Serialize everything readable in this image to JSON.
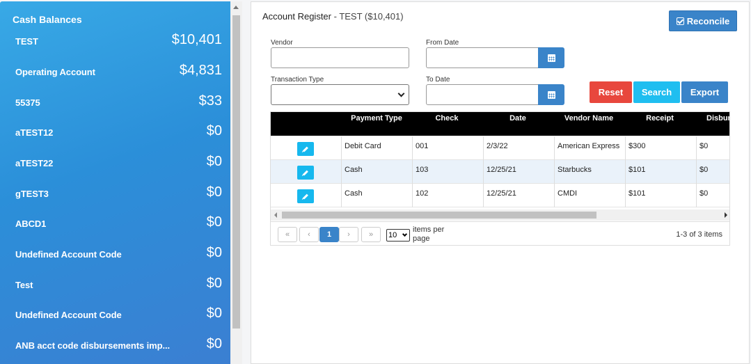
{
  "sidebar": {
    "title": "Cash Balances",
    "accounts": [
      {
        "name": "TEST",
        "amount": "$10,401"
      },
      {
        "name": "Operating Account",
        "amount": "$4,831"
      },
      {
        "name": "55375",
        "amount": "$33"
      },
      {
        "name": "aTEST12",
        "amount": "$0"
      },
      {
        "name": "aTEST22",
        "amount": "$0"
      },
      {
        "name": "gTEST3",
        "amount": "$0"
      },
      {
        "name": "ABCD1",
        "amount": "$0"
      },
      {
        "name": "Undefined Account Code",
        "amount": "$0"
      },
      {
        "name": "Test",
        "amount": "$0"
      },
      {
        "name": "Undefined Account Code",
        "amount": "$0"
      },
      {
        "name": "ANB acct code disbursements imp...",
        "amount": "$0"
      }
    ]
  },
  "header": {
    "title": "Account Register",
    "subtitle": " - TEST ($10,401)",
    "reconcile_label": "Reconcile"
  },
  "filters": {
    "vendor_label": "Vendor",
    "vendor_value": "",
    "from_date_label": "From Date",
    "from_date_value": "",
    "transaction_type_label": "Transaction Type",
    "transaction_type_value": "",
    "to_date_label": "To Date",
    "to_date_value": "",
    "reset_label": "Reset",
    "search_label": "Search",
    "export_label": "Export"
  },
  "grid": {
    "columns": [
      "",
      "Payment Type",
      "Check",
      "Date",
      "Vendor Name",
      "Receipt",
      "Disbur"
    ],
    "rows": [
      {
        "payment_type": "Debit Card",
        "check": "001",
        "date": "2/3/22",
        "vendor": "American Express",
        "receipt": "$300",
        "disbursement": "$0"
      },
      {
        "payment_type": "Cash",
        "check": "103",
        "date": "12/25/21",
        "vendor": "Starbucks",
        "receipt": "$101",
        "disbursement": "$0"
      },
      {
        "payment_type": "Cash",
        "check": "102",
        "date": "12/25/21",
        "vendor": "CMDI",
        "receipt": "$101",
        "disbursement": "$0"
      }
    ]
  },
  "pager": {
    "first": "«",
    "prev": "‹",
    "current_page": "1",
    "next": "›",
    "last": "»",
    "page_size": "10",
    "items_per_page_label": "items per page",
    "info": "1-3 of 3 items"
  },
  "colors": {
    "sidebar_gradient_start": "#38a9e6",
    "primary": "#3a84c9",
    "reset": "#e8473d",
    "search": "#1fbef0"
  }
}
